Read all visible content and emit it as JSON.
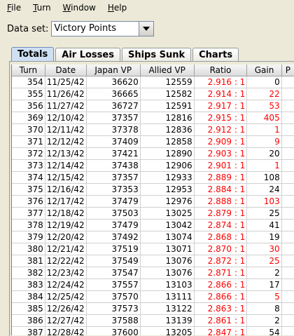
{
  "menu": [
    {
      "first": "F",
      "rest": "ile"
    },
    {
      "first": "T",
      "rest": "urn"
    },
    {
      "first": "W",
      "rest": "indow"
    },
    {
      "first": "H",
      "rest": "elp"
    }
  ],
  "dataset": {
    "label": "Data set:",
    "value": "Victory Points"
  },
  "tabs": [
    "Totals",
    "Air Losses",
    "Ships Sunk",
    "Charts"
  ],
  "active_tab": "Totals",
  "table": {
    "headers": [
      "Turn",
      "Date",
      "Japan VP",
      "Allied VP",
      "Ratio",
      "Gain",
      "P"
    ],
    "rows": [
      {
        "turn": "354",
        "date": "11/25/42",
        "japan": "36620",
        "allied": "12559",
        "ratio": "2.916 : 1",
        "gain": "0",
        "gain_red": false
      },
      {
        "turn": "355",
        "date": "11/26/42",
        "japan": "36665",
        "allied": "12582",
        "ratio": "2.914 : 1",
        "gain": "22",
        "gain_red": true
      },
      {
        "turn": "356",
        "date": "11/27/42",
        "japan": "36727",
        "allied": "12591",
        "ratio": "2.917 : 1",
        "gain": "53",
        "gain_red": true
      },
      {
        "turn": "369",
        "date": "12/10/42",
        "japan": "37357",
        "allied": "12816",
        "ratio": "2.915 : 1",
        "gain": "405",
        "gain_red": true
      },
      {
        "turn": "370",
        "date": "12/11/42",
        "japan": "37378",
        "allied": "12836",
        "ratio": "2.912 : 1",
        "gain": "1",
        "gain_red": true
      },
      {
        "turn": "371",
        "date": "12/12/42",
        "japan": "37409",
        "allied": "12858",
        "ratio": "2.909 : 1",
        "gain": "9",
        "gain_red": true
      },
      {
        "turn": "372",
        "date": "12/13/42",
        "japan": "37421",
        "allied": "12890",
        "ratio": "2.903 : 1",
        "gain": "20",
        "gain_red": false
      },
      {
        "turn": "373",
        "date": "12/14/42",
        "japan": "37438",
        "allied": "12906",
        "ratio": "2.901 : 1",
        "gain": "1",
        "gain_red": true
      },
      {
        "turn": "374",
        "date": "12/15/42",
        "japan": "37357",
        "allied": "12933",
        "ratio": "2.889 : 1",
        "gain": "108",
        "gain_red": false
      },
      {
        "turn": "375",
        "date": "12/16/42",
        "japan": "37353",
        "allied": "12953",
        "ratio": "2.884 : 1",
        "gain": "24",
        "gain_red": false
      },
      {
        "turn": "376",
        "date": "12/17/42",
        "japan": "37479",
        "allied": "12976",
        "ratio": "2.888 : 1",
        "gain": "103",
        "gain_red": true
      },
      {
        "turn": "377",
        "date": "12/18/42",
        "japan": "37503",
        "allied": "13025",
        "ratio": "2.879 : 1",
        "gain": "25",
        "gain_red": false
      },
      {
        "turn": "378",
        "date": "12/19/42",
        "japan": "37479",
        "allied": "13042",
        "ratio": "2.874 : 1",
        "gain": "41",
        "gain_red": false
      },
      {
        "turn": "379",
        "date": "12/20/42",
        "japan": "37492",
        "allied": "13074",
        "ratio": "2.868 : 1",
        "gain": "19",
        "gain_red": false
      },
      {
        "turn": "380",
        "date": "12/21/42",
        "japan": "37519",
        "allied": "13071",
        "ratio": "2.870 : 1",
        "gain": "30",
        "gain_red": true
      },
      {
        "turn": "381",
        "date": "12/22/42",
        "japan": "37549",
        "allied": "13076",
        "ratio": "2.872 : 1",
        "gain": "25",
        "gain_red": true
      },
      {
        "turn": "382",
        "date": "12/23/42",
        "japan": "37547",
        "allied": "13076",
        "ratio": "2.871 : 1",
        "gain": "2",
        "gain_red": false
      },
      {
        "turn": "383",
        "date": "12/24/42",
        "japan": "37557",
        "allied": "13103",
        "ratio": "2.866 : 1",
        "gain": "17",
        "gain_red": false
      },
      {
        "turn": "384",
        "date": "12/25/42",
        "japan": "37570",
        "allied": "13111",
        "ratio": "2.866 : 1",
        "gain": "5",
        "gain_red": true
      },
      {
        "turn": "385",
        "date": "12/26/42",
        "japan": "37573",
        "allied": "13122",
        "ratio": "2.863 : 1",
        "gain": "8",
        "gain_red": false
      },
      {
        "turn": "386",
        "date": "12/27/42",
        "japan": "37588",
        "allied": "13139",
        "ratio": "2.861 : 1",
        "gain": "2",
        "gain_red": false
      },
      {
        "turn": "387",
        "date": "12/28/42",
        "japan": "37600",
        "allied": "13205",
        "ratio": "2.847 : 1",
        "gain": "54",
        "gain_red": false
      }
    ]
  },
  "colors": {
    "ratio_text": "#ff0000",
    "gain_highlight": "#ff0000",
    "active_tab": "#cfe0f3"
  },
  "icons": {
    "dropdown": "chevron-down-icon"
  }
}
